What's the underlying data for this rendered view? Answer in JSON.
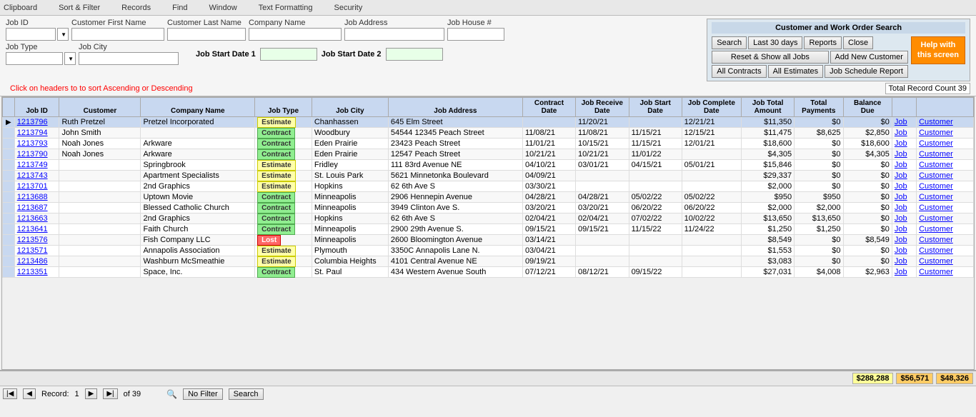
{
  "toolbar": {
    "sections": [
      "Clipboard",
      "Sort & Filter",
      "Records",
      "Find",
      "Window",
      "Text Formatting",
      "Security"
    ]
  },
  "search_panel": {
    "title": "Customer and Work Order Search",
    "fields": {
      "job_id_label": "Job ID",
      "customer_first_label": "Customer First Name",
      "customer_last_label": "Customer Last Name",
      "company_name_label": "Company Name",
      "job_address_label": "Job Address",
      "job_house_label": "Job House #",
      "job_type_label": "Job Type",
      "job_city_label": "Job City",
      "job_start_date1_label": "Job Start Date 1",
      "job_start_date2_label": "Job Start Date 2"
    },
    "buttons": {
      "search": "Search",
      "last30days": "Last 30 days",
      "reports": "Reports",
      "close": "Close",
      "reset": "Reset & Show all Jobs",
      "add_new_customer": "Add New Customer",
      "all_contracts": "All Contracts",
      "all_estimates": "All Estimates",
      "job_schedule": "Job Schedule Report",
      "help": "Help with\nthis screen"
    },
    "record_count_label": "Total Record Count 39"
  },
  "table": {
    "sort_hint": "Click on headers to to sort Ascending or Descending",
    "columns": [
      "Job ID",
      "Customer",
      "Company Name",
      "Job Type",
      "Job City",
      "Job Address",
      "Contract Date",
      "Job Receive Date",
      "Job Start Date",
      "Job Complete Date",
      "Job Total Amount",
      "Total Payments",
      "Balance Due",
      "Job",
      "Customer"
    ],
    "column_header_multiline": {
      "contract_date": [
        "Contract",
        "Date"
      ],
      "receive_date": [
        "Job Receive",
        "Date"
      ],
      "start_date": [
        "Job Start",
        "Date"
      ],
      "complete_date": [
        "Job Complete",
        "Date"
      ],
      "total_amount": [
        "Job Total",
        "Amount"
      ],
      "payments": [
        "Total",
        "Payments"
      ],
      "balance": [
        "Balance",
        "Due"
      ]
    },
    "rows": [
      {
        "id": "1213796",
        "customer": "Ruth Pretzel",
        "company": "Pretzel Incorporated",
        "job_type": "Estimate",
        "city": "Chanhassen",
        "address": "645 Elm Street",
        "contract_date": "",
        "receive_date": "11/20/21",
        "start_date": "",
        "complete_date": "12/21/21",
        "total_amount": "$11,350",
        "payments": "$0",
        "balance": "$0",
        "job": "Job",
        "cust": "Customer",
        "selected": true
      },
      {
        "id": "1213794",
        "customer": "John Smith",
        "company": "",
        "job_type": "Contract",
        "city": "Woodbury",
        "address": "54544 12345 Peach Street",
        "contract_date": "11/08/21",
        "receive_date": "11/08/21",
        "start_date": "11/15/21",
        "complete_date": "12/15/21",
        "total_amount": "$11,475",
        "payments": "$8,625",
        "balance": "$2,850",
        "job": "Job",
        "cust": "Customer"
      },
      {
        "id": "1213793",
        "customer": "Noah Jones",
        "company": "Arkware",
        "job_type": "Contract",
        "city": "Eden Prairie",
        "address": "23423 Peach Street",
        "contract_date": "11/01/21",
        "receive_date": "10/15/21",
        "start_date": "11/15/21",
        "complete_date": "12/01/21",
        "total_amount": "$18,600",
        "payments": "$0",
        "balance": "$18,600",
        "job": "Job",
        "cust": "Customer"
      },
      {
        "id": "1213790",
        "customer": "Noah Jones",
        "company": "Arkware",
        "job_type": "Contract",
        "city": "Eden Prairie",
        "address": "12547 Peach Street",
        "contract_date": "10/21/21",
        "receive_date": "10/21/21",
        "start_date": "11/01/22",
        "complete_date": "",
        "total_amount": "$4,305",
        "payments": "$0",
        "balance": "$4,305",
        "job": "Job",
        "cust": "Customer"
      },
      {
        "id": "1213749",
        "customer": "",
        "company": "Springbrook",
        "job_type": "Estimate",
        "city": "Fridley",
        "address": "111 83rd Avenue NE",
        "contract_date": "04/10/21",
        "receive_date": "03/01/21",
        "start_date": "04/15/21",
        "complete_date": "05/01/21",
        "total_amount": "$15,846",
        "payments": "$0",
        "balance": "$0",
        "job": "Job",
        "cust": "Customer"
      },
      {
        "id": "1213743",
        "customer": "",
        "company": "Apartment Specialists",
        "job_type": "Estimate",
        "city": "St. Louis Park",
        "address": "5621 Minnetonka Boulevard",
        "contract_date": "04/09/21",
        "receive_date": "",
        "start_date": "",
        "complete_date": "",
        "total_amount": "$29,337",
        "payments": "$0",
        "balance": "$0",
        "job": "Job",
        "cust": "Customer"
      },
      {
        "id": "1213701",
        "customer": "",
        "company": "2nd Graphics",
        "job_type": "Estimate",
        "city": "Hopkins",
        "address": "62 6th Ave S",
        "contract_date": "03/30/21",
        "receive_date": "",
        "start_date": "",
        "complete_date": "",
        "total_amount": "$2,000",
        "payments": "$0",
        "balance": "$0",
        "job": "Job",
        "cust": "Customer"
      },
      {
        "id": "1213688",
        "customer": "",
        "company": "Uptown Movie",
        "job_type": "Contract",
        "city": "Minneapolis",
        "address": "2906 Hennepin Avenue",
        "contract_date": "04/28/21",
        "receive_date": "04/28/21",
        "start_date": "05/02/22",
        "complete_date": "05/02/22",
        "total_amount": "$950",
        "payments": "$950",
        "balance": "$0",
        "job": "Job",
        "cust": "Customer"
      },
      {
        "id": "1213687",
        "customer": "",
        "company": "Blessed Catholic Church",
        "job_type": "Contract",
        "city": "Minneapolis",
        "address": "3949 Clinton Ave S.",
        "contract_date": "03/20/21",
        "receive_date": "03/20/21",
        "start_date": "06/20/22",
        "complete_date": "06/20/22",
        "total_amount": "$2,000",
        "payments": "$2,000",
        "balance": "$0",
        "job": "Job",
        "cust": "Customer"
      },
      {
        "id": "1213663",
        "customer": "",
        "company": "2nd Graphics",
        "job_type": "Contract",
        "city": "Hopkins",
        "address": "62 6th Ave S",
        "contract_date": "02/04/21",
        "receive_date": "02/04/21",
        "start_date": "07/02/22",
        "complete_date": "10/02/22",
        "total_amount": "$13,650",
        "payments": "$13,650",
        "balance": "$0",
        "job": "Job",
        "cust": "Customer"
      },
      {
        "id": "1213641",
        "customer": "",
        "company": "Faith Church",
        "job_type": "Contract",
        "city": "Minneapolis",
        "address": "2900 29th Avenue S.",
        "contract_date": "09/15/21",
        "receive_date": "09/15/21",
        "start_date": "11/15/22",
        "complete_date": "11/24/22",
        "total_amount": "$1,250",
        "payments": "$1,250",
        "balance": "$0",
        "job": "Job",
        "cust": "Customer"
      },
      {
        "id": "1213576",
        "customer": "",
        "company": "Fish Company LLC",
        "job_type": "Lost",
        "city": "Minneapolis",
        "address": "2600 Bloomington Avenue",
        "contract_date": "03/14/21",
        "receive_date": "",
        "start_date": "",
        "complete_date": "",
        "total_amount": "$8,549",
        "payments": "$0",
        "balance": "$8,549",
        "job": "Job",
        "cust": "Customer"
      },
      {
        "id": "1213571",
        "customer": "",
        "company": "Annapolis Association",
        "job_type": "Estimate",
        "city": "Plymouth",
        "address": "3350C Annapolis Lane N.",
        "contract_date": "03/04/21",
        "receive_date": "",
        "start_date": "",
        "complete_date": "",
        "total_amount": "$1,553",
        "payments": "$0",
        "balance": "$0",
        "job": "Job",
        "cust": "Customer"
      },
      {
        "id": "1213486",
        "customer": "",
        "company": "Washburn McSmeathie",
        "job_type": "Estimate",
        "city": "Columbia Heights",
        "address": "4101 Central Avenue NE",
        "contract_date": "09/19/21",
        "receive_date": "",
        "start_date": "",
        "complete_date": "",
        "total_amount": "$3,083",
        "payments": "$0",
        "balance": "$0",
        "job": "Job",
        "cust": "Customer"
      },
      {
        "id": "1213351",
        "customer": "",
        "company": "Space, Inc.",
        "job_type": "Contract",
        "city": "St. Paul",
        "address": "434 Western Avenue South",
        "contract_date": "07/12/21",
        "receive_date": "08/12/21",
        "start_date": "09/15/22",
        "complete_date": "",
        "total_amount": "$27,031",
        "payments": "$4,008",
        "balance": "$2,963",
        "job": "Job",
        "cust": "Customer"
      }
    ],
    "totals": {
      "total_amount": "$288,288",
      "payments": "$56,571",
      "balance": "$48,326"
    }
  },
  "status_bar": {
    "record_label": "Record:",
    "current": "1",
    "of": "of 39",
    "no_filter": "No Filter",
    "search_btn": "Search"
  }
}
